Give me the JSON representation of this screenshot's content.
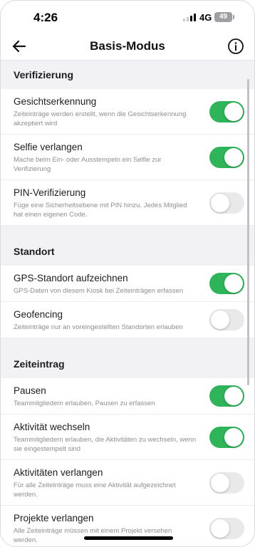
{
  "status_bar": {
    "time": "4:26",
    "network": "4G",
    "battery": "49"
  },
  "nav": {
    "title": "Basis-Modus",
    "back_icon": "arrow-left-icon",
    "info_icon": "info-circle-icon"
  },
  "sections": [
    {
      "title": "Verifizierung",
      "rows": [
        {
          "title": "Gesichtserkennung",
          "subtitle": "Zeiteinträge werden erstellt, wenn die Gesichtserkennung akzeptiert wird",
          "enabled": true
        },
        {
          "title": "Selfie verlangen",
          "subtitle": "Mache beim Ein- oder Ausstempeln ein Selfie zur Verifizierung",
          "enabled": true
        },
        {
          "title": "PIN-Verifizierung",
          "subtitle": "Füge eine Sicherheitsebene mit PIN hinzu. Jedes Mitglied hat einen eigenen Code.",
          "enabled": false
        }
      ]
    },
    {
      "title": "Standort",
      "rows": [
        {
          "title": "GPS-Standort aufzeichnen",
          "subtitle": "GPS-Daten von diesem Kiosk bei Zeiteinträgen erfassen",
          "enabled": true
        },
        {
          "title": "Geofencing",
          "subtitle": "Zeiteinträge nur an voreingestellten Standorten erlauben",
          "enabled": false
        }
      ]
    },
    {
      "title": "Zeiteintrag",
      "rows": [
        {
          "title": "Pausen",
          "subtitle": "Teammitgliedern erlauben, Pausen zu erfassen",
          "enabled": true
        },
        {
          "title": "Aktivität wechseln",
          "subtitle": "Teammitgliedern erlauben, die Aktivitäten zu wechseln, wenn sie eingestempelt sind",
          "enabled": true
        },
        {
          "title": "Aktivitäten verlangen",
          "subtitle": "Für alle Zeiteinträge muss eine Aktivität aufgezeichnet werden.",
          "enabled": false
        },
        {
          "title": "Projekte verlangen",
          "subtitle": "Alle Zeiteinträge müssen mit einem Projekt versehen werden.",
          "enabled": false
        }
      ]
    }
  ],
  "colors": {
    "toggle_on": "#2fb45a",
    "toggle_off": "#e9e9ea"
  }
}
